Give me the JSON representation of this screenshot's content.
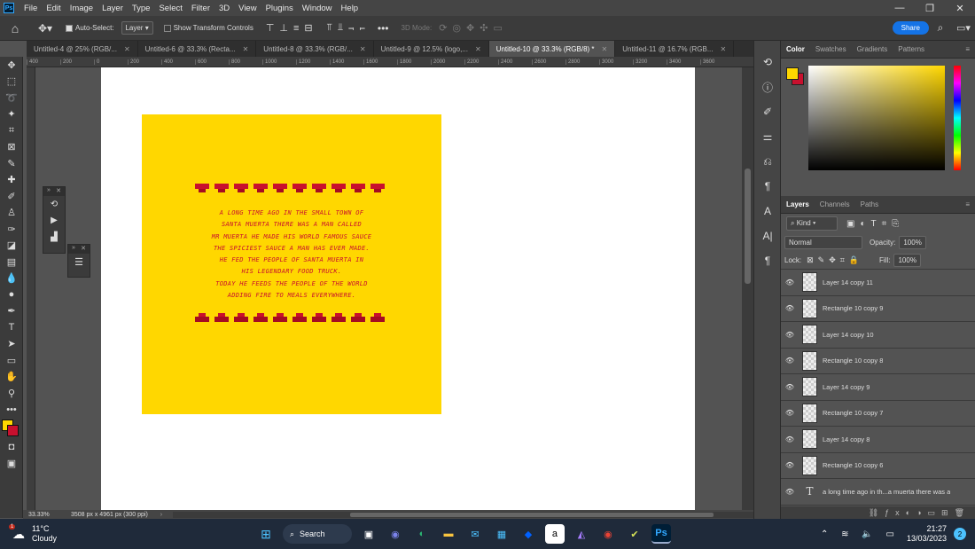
{
  "menubar": {
    "items": [
      "File",
      "Edit",
      "Image",
      "Layer",
      "Type",
      "Select",
      "Filter",
      "3D",
      "View",
      "Plugins",
      "Window",
      "Help"
    ],
    "logo_text": "Ps"
  },
  "options": {
    "auto_select_label": "Auto-Select:",
    "auto_select_value": "Layer",
    "transform_label": "Show Transform Controls",
    "mode_3d_label": "3D Mode:",
    "share_label": "Share"
  },
  "tabs": [
    {
      "label": "Untitled-4 @ 25% (RGB/...",
      "active": false
    },
    {
      "label": "Untitled-6 @ 33.3% (Recta...",
      "active": false
    },
    {
      "label": "Untitled-8 @ 33.3% (RGB/...",
      "active": false
    },
    {
      "label": "Untitled-9 @ 12.5% (logo,...",
      "active": false
    },
    {
      "label": "Untitled-10 @ 33.3% (RGB/8) *",
      "active": true
    },
    {
      "label": "Untitled-11 @ 16.7% (RGB...",
      "active": false
    }
  ],
  "ruler_top": [
    "400",
    "200",
    "0",
    "200",
    "400",
    "600",
    "800",
    "1000",
    "1200",
    "1400",
    "1600",
    "1800",
    "2000",
    "2200",
    "2400",
    "2600",
    "2800",
    "3000",
    "3200",
    "3400",
    "3600"
  ],
  "artwork": {
    "deco_count": 10,
    "story_lines": [
      "A long time ago in the small town of",
      "Santa Muerta there was a man called",
      "Mr Muerta he made his world famous sauce",
      "The spiciest sauce a man has ever made.",
      "He fed the people of Santa Muerta in",
      "his legendary food truck.",
      "Today he feeds the people of the world",
      "adding fire to meals everywhere."
    ]
  },
  "status": {
    "zoom": "33.33%",
    "doc_size": "3508 px x 4961 px (300 ppi)"
  },
  "right_panel": {
    "color_tabs": [
      "Color",
      "Swatches",
      "Gradients",
      "Patterns"
    ],
    "layer_tabs": [
      "Layers",
      "Channels",
      "Paths"
    ],
    "kind_label": "Kind",
    "blend_mode": "Normal",
    "opacity_label": "Opacity:",
    "opacity_value": "100%",
    "lock_label": "Lock:",
    "fill_label": "Fill:",
    "fill_value": "100%",
    "layers": [
      {
        "name": "Layer 14 copy 11",
        "type": "raster"
      },
      {
        "name": "Rectangle 10 copy 9",
        "type": "raster"
      },
      {
        "name": "Layer 14 copy 10",
        "type": "raster"
      },
      {
        "name": "Rectangle 10 copy 8",
        "type": "raster"
      },
      {
        "name": "Layer 14 copy 9",
        "type": "raster"
      },
      {
        "name": "Rectangle 10 copy 7",
        "type": "raster"
      },
      {
        "name": "Layer 14 copy 8",
        "type": "raster"
      },
      {
        "name": "Rectangle 10 copy 6",
        "type": "raster"
      },
      {
        "name": "a long time ago in th...a muerta there was a",
        "type": "text"
      }
    ]
  },
  "taskbar": {
    "weather_temp": "11°C",
    "weather_desc": "Cloudy",
    "weather_badge": "1",
    "search_label": "Search",
    "time": "21:27",
    "date": "13/03/2023",
    "notif_count": "2"
  },
  "colors": {
    "artboard": "#ffd700",
    "text": "#c8102e",
    "accent": "#1473e6"
  }
}
